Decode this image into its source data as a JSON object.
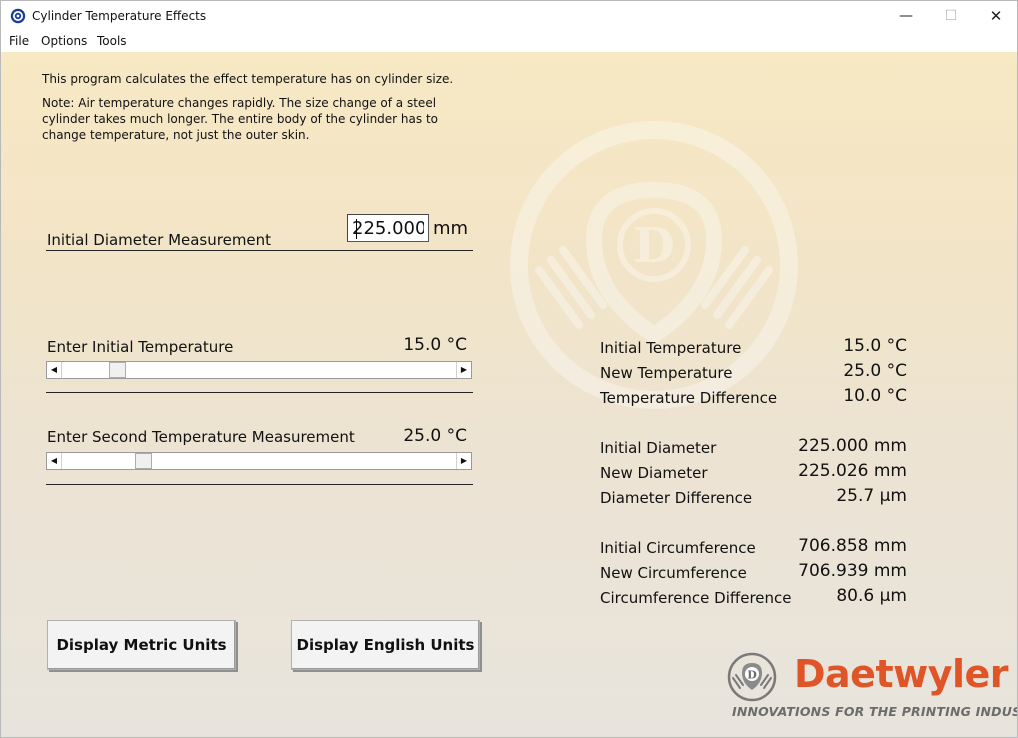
{
  "window": {
    "title": "Cylinder Temperature Effects",
    "controls": {
      "minimize": "—",
      "maximize": "☐",
      "close": "✕"
    }
  },
  "menu": {
    "items": [
      "File",
      "Options",
      "Tools"
    ]
  },
  "intro": {
    "line": "This program calculates the effect temperature has on cylinder size.",
    "note_lines": [
      "Note:  Air temperature changes rapidly. The size change of a steel",
      "cylinder takes much longer.  The entire body of the cylinder has to",
      "change temperature, not just the outer skin."
    ]
  },
  "diameter_input": {
    "label": "Initial Diameter Measurement",
    "value": "225.000",
    "unit": "mm"
  },
  "initial_temp": {
    "label": "Enter Initial Temperature",
    "value": "15.0 °C",
    "slider_level": 0.127
  },
  "second_temp": {
    "label": "Enter Second Temperature Measurement",
    "value": "25.0 °C",
    "slider_level": 0.195
  },
  "results": {
    "temperature": [
      {
        "label": "Initial Temperature",
        "value": "15.0 °C"
      },
      {
        "label": "New Temperature",
        "value": "25.0 °C"
      },
      {
        "label": "Temperature Difference",
        "value": "10.0 °C"
      }
    ],
    "diameter": [
      {
        "label": "Initial Diameter",
        "value": "225.000 mm"
      },
      {
        "label": "New Diameter",
        "value": "225.026 mm"
      },
      {
        "label": "Diameter Difference",
        "value": "25.7 µm"
      }
    ],
    "circumference": [
      {
        "label": "Initial Circumference",
        "value": "706.858 mm"
      },
      {
        "label": "New Circumference",
        "value": "706.939 mm"
      },
      {
        "label": "Circumference Difference",
        "value": "80.6 µm"
      }
    ]
  },
  "buttons": {
    "metric": "Display Metric Units",
    "english": "Display English Units"
  },
  "logo": {
    "brand": "Daetwyler",
    "tagline": "INNOVATIONS FOR THE PRINTING INDUSTRY",
    "brand_color": "#e05528",
    "emblem_letter": "D"
  },
  "colors": {
    "background_top": "#f7e9c3",
    "background_bottom": "#e8e4dd",
    "watermark": "#ffffff"
  }
}
